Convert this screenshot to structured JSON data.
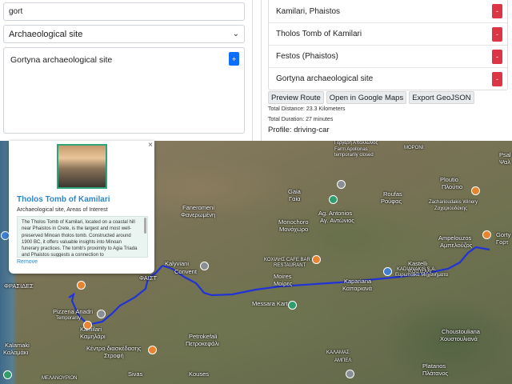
{
  "search": {
    "value": "gort"
  },
  "category": {
    "selected": "Archaeological site"
  },
  "results": [
    {
      "label": "Gortyna archaeological site",
      "add_label": "+"
    }
  ],
  "route": {
    "items": [
      {
        "label": "Kamilari, Phaistos",
        "remove_label": "-"
      },
      {
        "label": "Tholos Tomb of Kamilari",
        "remove_label": "-"
      },
      {
        "label": "Festos (Phaistos)",
        "remove_label": "-"
      },
      {
        "label": "Gortyna archaeological site",
        "remove_label": "-"
      }
    ],
    "actions": {
      "preview": "Preview Route",
      "google": "Open in Google Maps",
      "geojson": "Export GeoJSON"
    },
    "total_distance": "Total Distance: 23.3 Kilometers",
    "total_duration": "Total Duration: 27 minutes",
    "profile": "Profile: driving-car",
    "line_color": "#2233d6"
  },
  "popup": {
    "close": "×",
    "title": "Tholos Tomb of Kamilari",
    "category": "Archaeological site, Areas of Interest",
    "description": "The Tholos Tomb of Kamilari, located on a coastal hill near Phaistos in Crete, is the largest and most well-preserved Minoan tholos tomb. Constructed around 1900 BC, it offers valuable insights into Minoan funerary practices. The tomb's proximity to Agia Triada and Phaistos suggests a connection to",
    "remove": "Remove",
    "accent": "#2e87c7"
  },
  "map_labels": {
    "moroni": "ΜΟΡΟΝΙ",
    "gergeri": "Γέργερη Απόλλωνος",
    "farm_line1": "Farm Apollonas",
    "farm_line2": "temporarily closed",
    "gaia": "Gaia",
    "gaia_gr": "Γαία",
    "roufas": "Roufas",
    "roufas_gr": "Ρούφας",
    "ploutio": "Ploutio",
    "ploutio_gr": "Πλούτιο",
    "winery": "Zacharioudakis Winery",
    "winery_gr": "Ζαχαριουδάκης",
    "psalidi": "Psal",
    "psalidi_gr": "Ψαλ",
    "faneromeni": "Faneromeni",
    "faneromeni_gr": "Φανερωμένη",
    "monochoro": "Monochoro",
    "monochoro_gr": "Μονόχωρο",
    "ag_antonios": "Ag. Antonios",
    "ag_antonios_gr": "Αγ. Αντώνιος",
    "ampelouzos": "Ampelouzos",
    "ampelouzos_gr": "Αμπελούζος",
    "gortyna": "Gorty",
    "gortyna_gr": "Γορτ",
    "kastelli": "Kastelli",
    "kastelli_gr": "Καστέλλι",
    "kalyviani": "Kalyviani",
    "convent": "Convent",
    "koxilis": "ΚΟΧΙΛΗΣ CAFE BAR",
    "restaurant": "RESTAURANT",
    "moires": "Moires",
    "moires_gr": "Μοίρες",
    "kaparianа": "Kapariana",
    "kapariana_gr": "Καπαριανά",
    "kadianakis": "KADIANAKIS S.A.",
    "kadianakis_gr": "Ευρωπαϊκά Μηχανήματα",
    "messara": "Messara Kart",
    "faistos": "ΦΑΙΣΤ",
    "fraasides": "ΦΡΑΣΙΔΕΣ",
    "pizzeria": "Pizzeria Anadri",
    "pizzeria_gr": "Temporarily",
    "kamilari": "Kamilari",
    "kamilari_gr": "Καμηλάρι",
    "kentro": "Κέντρο διασκέδασης",
    "kentro_gr": "Στροφή",
    "kalamaki": "Kalamaki",
    "kalamaki_gr": "Καλαμάκι",
    "petrokefali": "Petrokefali",
    "petrokefali_gr": "Πετροκεφάλι",
    "choustouliana": "Choustouliana",
    "choustouliana_gr": "Χουστουλιανά",
    "kalamas": "ΚΑΛΑΜΑΣ",
    "ampelos": "ΑΜΠΕΛ",
    "platanos": "Platanos",
    "platanos_gr": "Πλάτανος",
    "sivas": "Sivas",
    "kouses": "Kouses",
    "melanoyrion": "ΜΕΛΑΝΟΥΡΙΟΝ"
  },
  "icons": {
    "close": "close-icon",
    "chevron": "chevron-down-icon",
    "poi_orange": "restaurant-pin-icon",
    "poi_gray": "landmark-pin-icon",
    "poi_green": "attraction-pin-icon",
    "poi_blue": "shop-pin-icon"
  }
}
